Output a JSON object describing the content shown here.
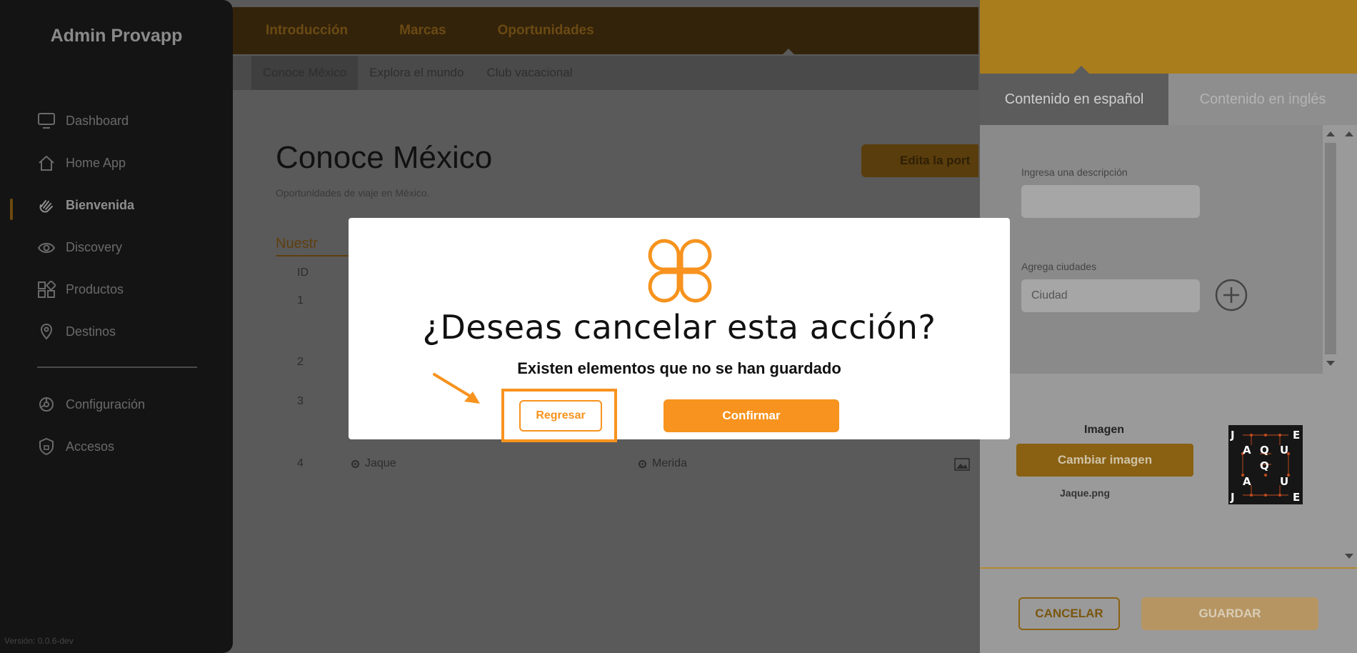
{
  "sidebar": {
    "brand": "Admin Provapp",
    "items": [
      {
        "label": "Dashboard",
        "icon": "monitor-icon"
      },
      {
        "label": "Home App",
        "icon": "home-icon"
      },
      {
        "label": "Bienvenida",
        "icon": "wave-hand-icon",
        "active": true
      },
      {
        "label": "Discovery",
        "icon": "eye-icon"
      },
      {
        "label": "Productos",
        "icon": "grid-icon"
      },
      {
        "label": "Destinos",
        "icon": "location-pin-icon"
      },
      {
        "label": "Configuración",
        "icon": "settings-icon"
      },
      {
        "label": "Accesos",
        "icon": "shield-icon"
      }
    ],
    "version": "Versión: 0.0.6-dev"
  },
  "topnav": {
    "tabs": [
      "Introducción",
      "Marcas",
      "Oportunidades"
    ]
  },
  "subnav": {
    "tabs": [
      "Conoce México",
      "Explora el mundo",
      "Club vacacional"
    ]
  },
  "main": {
    "title": "Conoce México",
    "subtitle": "Oportunidades de viaje en México.",
    "edit_button": "Edita la port",
    "section_tab": "Nuestr",
    "id_header": "ID",
    "rows": [
      {
        "id": "1"
      },
      {
        "id": "2"
      },
      {
        "id": "3"
      },
      {
        "id": "4",
        "name": "Jaque",
        "city": "Merida"
      }
    ]
  },
  "panel": {
    "tabs": [
      "Contenido en español",
      "Contenido en inglés"
    ],
    "description_label": "Ingresa una descripción",
    "description_value": "",
    "cities_label": "Agrega ciudades",
    "cities_placeholder": "Ciudad",
    "image_label": "Imagen",
    "change_image_button": "Cambiar imagen",
    "file_name": "Jaque.png",
    "jaque_letters": [
      "J",
      "E",
      "A",
      "Q",
      "U",
      "Q",
      "A",
      "U",
      "J",
      "E"
    ],
    "cancel_button": "CANCELAR",
    "save_button": "GUARDAR"
  },
  "modal": {
    "title": "¿Deseas cancelar esta acción?",
    "subtitle": "Existen elementos que no se han guardado",
    "back_button": "Regresar",
    "confirm_button": "Confirmar"
  },
  "colors": {
    "accent": "#f7931e",
    "sidebar_bg": "#141414",
    "panel_header": "#a97c1c"
  }
}
